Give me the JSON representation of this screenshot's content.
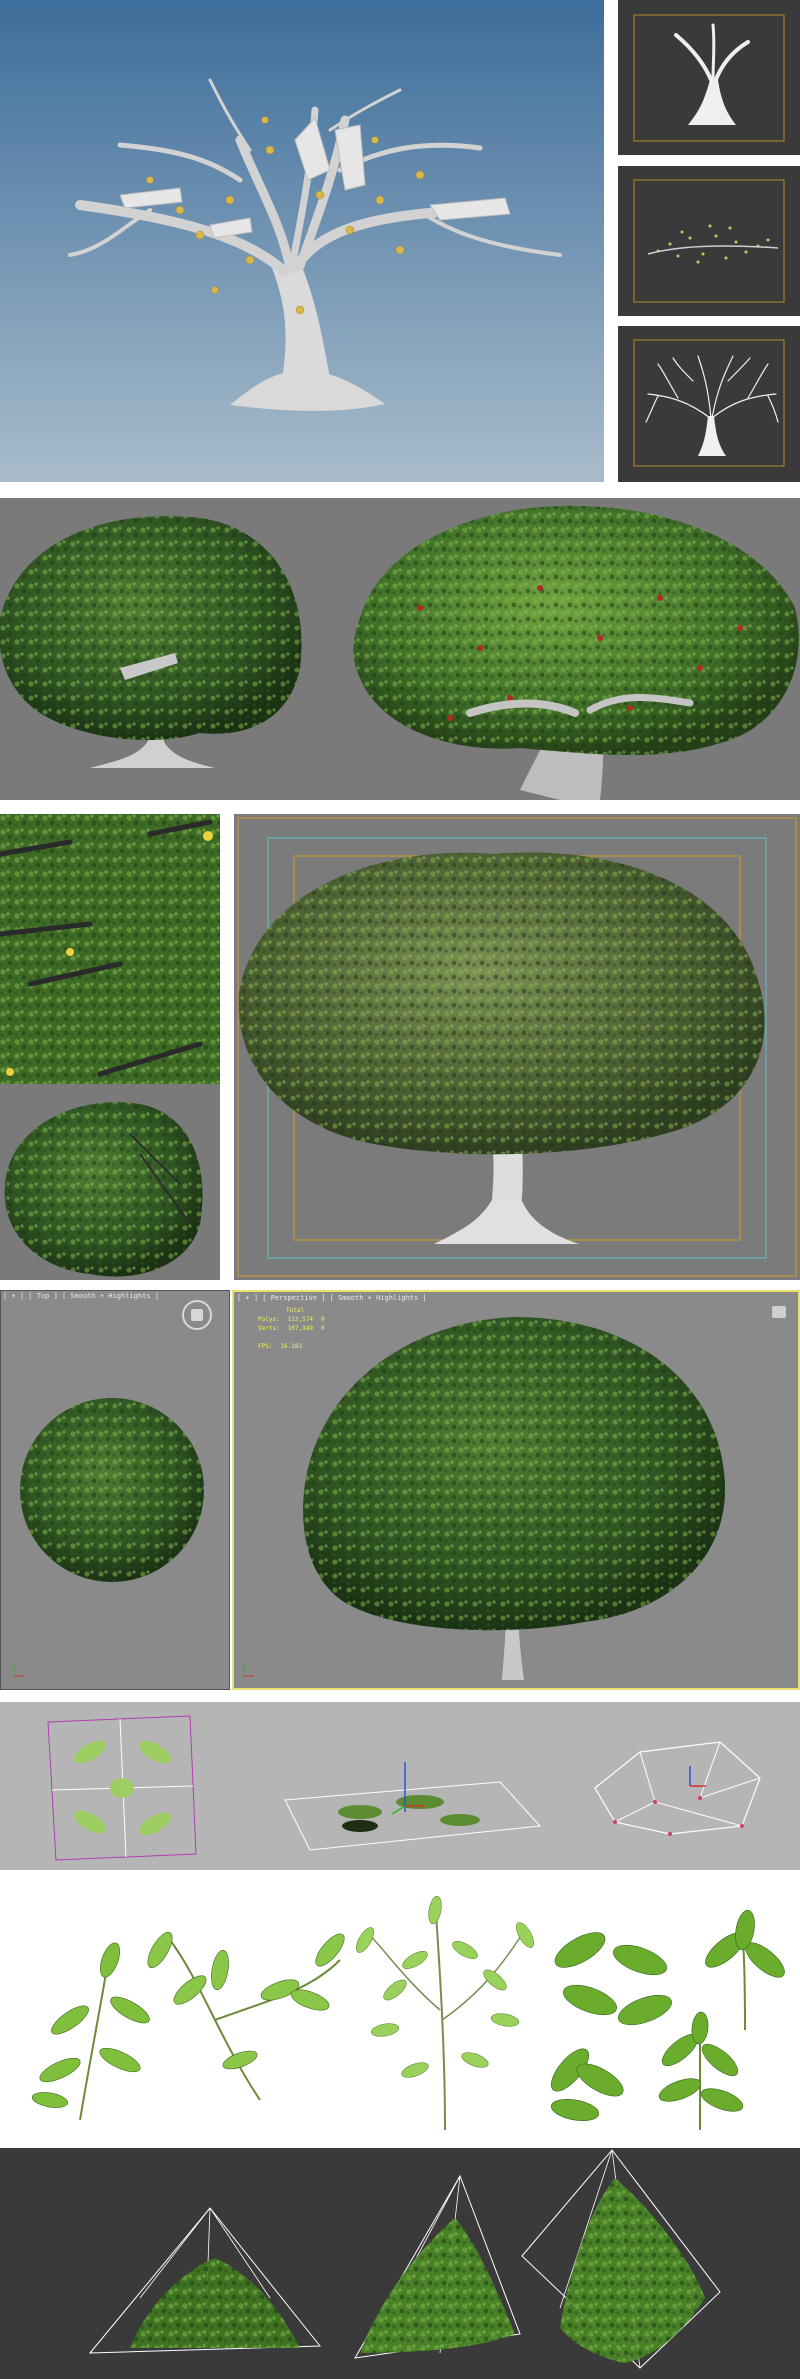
{
  "viewports": {
    "top": {
      "label": "[ + ] [ Top ] [ Smooth + Highlights ]"
    },
    "perspective": {
      "label": "[ + ] [ Perspective ] [ Smooth + Highlights ]"
    }
  },
  "stats": {
    "total_label": "Total",
    "polys_label": "Polys:",
    "polys_value": "113,574",
    "polys_extra": "0",
    "verts_label": "Verts:",
    "verts_value": "107,349",
    "verts_extra": "0",
    "fps_label": "FPS:",
    "fps_value": "16.183"
  },
  "colors": {
    "sky_top": "#3f6f9c",
    "sky_bottom": "#a9bccb",
    "viewport_gray": "#808080",
    "dark_viewport": "#3c3c3c",
    "foliage_dark": "#1f3d17",
    "foliage_mid": "#3d6b25",
    "foliage_light": "#7ab348",
    "trunk": "#d8d8d8",
    "active_border": "#e8e070",
    "safe_frame_orange": "#d49a2a",
    "safe_frame_cyan": "#5fc3c3"
  }
}
